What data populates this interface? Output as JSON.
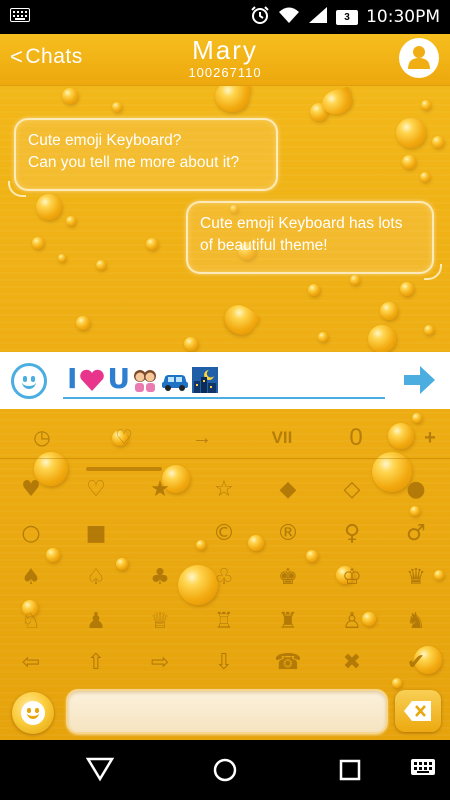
{
  "status_bar": {
    "time": "10:30PM",
    "battery_level": "3",
    "icons": [
      "keyboard-icon",
      "alarm-icon",
      "wifi-icon",
      "signal-icon",
      "battery-icon"
    ]
  },
  "header": {
    "back_label": "Chats",
    "contact_name": "Mary",
    "contact_id": "100267110"
  },
  "messages": [
    {
      "direction": "incoming",
      "lines": [
        "Cute emoji Keyboard?",
        "Can you tell me more about it?"
      ]
    },
    {
      "direction": "outgoing",
      "lines": [
        "Cute emoji Keyboard has lots",
        "of beautiful theme!"
      ]
    }
  ],
  "preview_input": {
    "text_letters": [
      "I",
      "U"
    ],
    "emojis": [
      "heart-emoji",
      "couple-emoji",
      "car-emoji",
      "night-city-emoji"
    ]
  },
  "keyboard": {
    "tabs": [
      {
        "id": "recent",
        "label": "◷"
      },
      {
        "id": "hearts",
        "label": "♡"
      },
      {
        "id": "arrows",
        "label": "→"
      },
      {
        "id": "numerals",
        "label": "VII"
      },
      {
        "id": "math",
        "label": "0"
      },
      {
        "id": "plus",
        "label": "+"
      }
    ],
    "active_tab": "hearts",
    "symbols": [
      [
        "♥",
        "♡",
        "★",
        "☆",
        "◆",
        "◇",
        "●"
      ],
      [
        "○",
        "■",
        "©",
        "®",
        "♀",
        "♂"
      ],
      [
        "♠",
        "♤",
        "♣",
        "♧",
        "♚",
        "♔",
        "♛"
      ],
      [
        "♘",
        "♟",
        "♕",
        "♖",
        "♜",
        "♙",
        "♞"
      ],
      [
        "⇦",
        "⇧",
        "⇨",
        "⇩",
        "☎",
        "✖",
        "✔"
      ]
    ]
  },
  "accent_color": "#4aaee0",
  "theme_color": "#eeaf14",
  "navigation": {
    "buttons": [
      "back",
      "home",
      "recents",
      "keyboard"
    ]
  }
}
